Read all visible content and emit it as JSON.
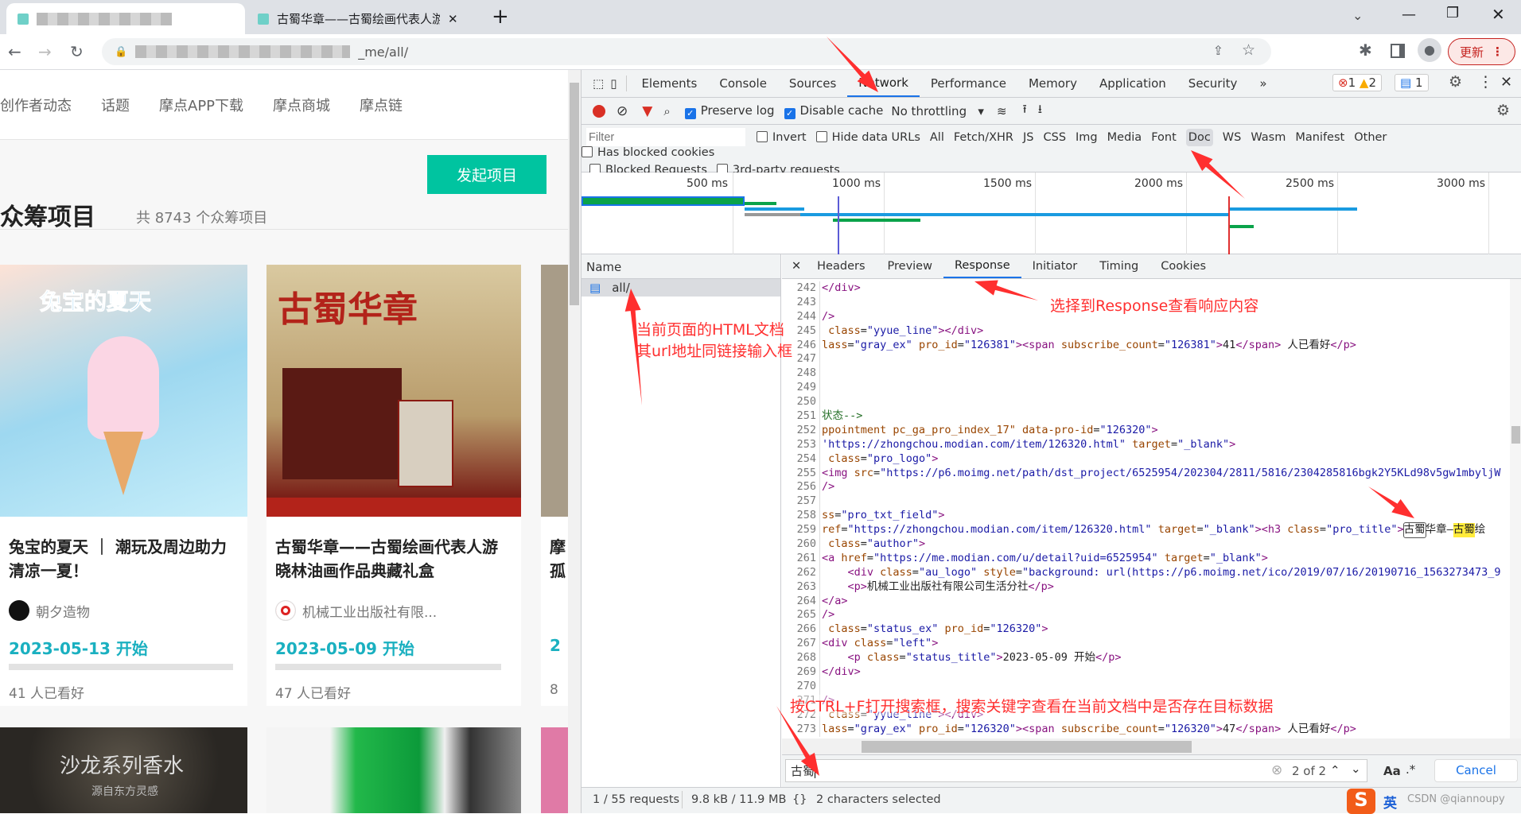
{
  "browser": {
    "tab1_title": "",
    "tab2_title": "古蜀华章——古蜀绘画代表人游晓",
    "url_visible": "_me/all/",
    "update_label": "更新"
  },
  "page": {
    "nav": [
      "创作者动态",
      "话题",
      "摩点APP下载",
      "摩点商城",
      "摩点链"
    ],
    "launch_button": "发起项目",
    "heading": "众筹项目",
    "count": "共 8743 个众筹项目",
    "cards": [
      {
        "title": "兔宝的夏天 ｜ 潮玩及周边助力清凉一夏！",
        "author": "朝夕造物",
        "date": "2023-05-13 开始",
        "watchers": "41 人已看好",
        "image_text": "兔宝的夏天",
        "image_color": "#9ed8f0"
      },
      {
        "title": "古蜀华章——古蜀绘画代表人游晓林油画作品典藏礼盒",
        "author": "机械工业出版社有限...",
        "date": "2023-05-09 开始",
        "watchers": "47 人已看好",
        "image_text": "古蜀华章",
        "image_color": "#c9b78a"
      },
      {
        "title": "摩孤",
        "author": "",
        "date": "2",
        "watchers": "8",
        "image_text": "",
        "image_color": "#a89c88"
      }
    ],
    "row2": [
      {
        "image_text": "沙龙系列香水",
        "image_sub": "源自东方灵感"
      },
      {
        "image_text": ""
      }
    ]
  },
  "devtools": {
    "tabs": [
      "Elements",
      "Console",
      "Sources",
      "Network",
      "Performance",
      "Memory",
      "Application",
      "Security",
      "»"
    ],
    "active_tab": "Network",
    "errors": "1",
    "warnings": "2",
    "messages": "1",
    "toolbar": {
      "preserve_log": "Preserve log",
      "disable_cache": "Disable cache",
      "throttling": "No throttling"
    },
    "filter": {
      "placeholder": "Filter",
      "invert": "Invert",
      "hide_data_urls": "Hide data URLs",
      "types": [
        "All",
        "Fetch/XHR",
        "JS",
        "CSS",
        "Img",
        "Media",
        "Font",
        "Doc",
        "WS",
        "Wasm",
        "Manifest",
        "Other"
      ],
      "active_type": "Doc",
      "has_blocked_cookies": "Has blocked cookies",
      "blocked_requests": "Blocked Requests",
      "third_party": "3rd-party requests"
    },
    "timeline_ticks": [
      "500 ms",
      "1000 ms",
      "1500 ms",
      "2000 ms",
      "2500 ms",
      "3000 ms"
    ],
    "name_header": "Name",
    "requests": [
      "all/"
    ],
    "detail_tabs": [
      "Headers",
      "Preview",
      "Response",
      "Initiator",
      "Timing",
      "Cookies"
    ],
    "active_detail_tab": "Response",
    "code": [
      [
        242,
        [
          [
            "t",
            "</div>"
          ]
        ]
      ],
      [
        243,
        []
      ],
      [
        244,
        [
          [
            "t",
            "/>"
          ]
        ]
      ],
      [
        245,
        [
          [
            "x",
            " "
          ],
          [
            "a",
            "class"
          ],
          [
            "x",
            "="
          ],
          [
            "v",
            "\"yyue_line\""
          ],
          [
            "t",
            "></div>"
          ]
        ]
      ],
      [
        246,
        [
          [
            "a",
            "lass"
          ],
          [
            "x",
            "="
          ],
          [
            "v",
            "\"gray_ex\""
          ],
          [
            "x",
            " "
          ],
          [
            "a",
            "pro_id"
          ],
          [
            "x",
            "="
          ],
          [
            "v",
            "\"126381\""
          ],
          [
            "t",
            "><span "
          ],
          [
            "a",
            "subscribe_count"
          ],
          [
            "x",
            "="
          ],
          [
            "v",
            "\"126381\""
          ],
          [
            "t",
            ">"
          ],
          [
            "x",
            "41"
          ],
          [
            "t",
            "</span>"
          ],
          [
            "x",
            " 人已看好"
          ],
          [
            "t",
            "</p>"
          ]
        ]
      ],
      [
        247,
        []
      ],
      [
        248,
        []
      ],
      [
        249,
        []
      ],
      [
        250,
        []
      ],
      [
        251,
        [
          [
            "c",
            "状态-->"
          ]
        ]
      ],
      [
        252,
        [
          [
            "a",
            "ppointment pc_ga_pro_index_17\" data-pro-id"
          ],
          [
            "x",
            "="
          ],
          [
            "v",
            "\"126320\""
          ],
          [
            "t",
            ">"
          ]
        ]
      ],
      [
        253,
        [
          [
            "v",
            "'https://zhongchou.modian.com/item/126320.html\""
          ],
          [
            "x",
            " "
          ],
          [
            "a",
            "target"
          ],
          [
            "x",
            "="
          ],
          [
            "v",
            "\"_blank\""
          ],
          [
            "t",
            ">"
          ]
        ]
      ],
      [
        254,
        [
          [
            "x",
            " "
          ],
          [
            "a",
            "class"
          ],
          [
            "x",
            "="
          ],
          [
            "v",
            "\"pro_logo\""
          ],
          [
            "t",
            ">"
          ]
        ]
      ],
      [
        255,
        [
          [
            "t",
            "<img "
          ],
          [
            "a",
            "src"
          ],
          [
            "x",
            "="
          ],
          [
            "v",
            "\"https://p6.moimg.net/path/dst_project/6525954/202304/2811/5816/2304285816bgk2Y5KLd98v5gw1mbyljW"
          ]
        ]
      ],
      [
        256,
        [
          [
            "t",
            "/>"
          ]
        ]
      ],
      [
        257,
        []
      ],
      [
        258,
        [
          [
            "a",
            "ss"
          ],
          [
            "x",
            "="
          ],
          [
            "v",
            "\"pro_txt_field\""
          ],
          [
            "t",
            ">"
          ]
        ]
      ],
      [
        259,
        [
          [
            "a",
            "ref"
          ],
          [
            "x",
            "="
          ],
          [
            "v",
            "\"https://zhongchou.modian.com/item/126320.html\""
          ],
          [
            "x",
            " "
          ],
          [
            "a",
            "target"
          ],
          [
            "x",
            "="
          ],
          [
            "v",
            "\"_blank\""
          ],
          [
            "t",
            "><h3 "
          ],
          [
            "a",
            "class"
          ],
          [
            "x",
            "="
          ],
          [
            "v",
            "\"pro_title\""
          ],
          [
            "t",
            ">"
          ],
          [
            "cur",
            "古蜀"
          ],
          [
            "x",
            "华章—"
          ],
          [
            "hl",
            "古蜀"
          ],
          [
            "x",
            "绘"
          ]
        ]
      ],
      [
        260,
        [
          [
            "x",
            " "
          ],
          [
            "a",
            "class"
          ],
          [
            "x",
            "="
          ],
          [
            "v",
            "\"author\""
          ],
          [
            "t",
            ">"
          ]
        ]
      ],
      [
        261,
        [
          [
            "t",
            "<a "
          ],
          [
            "a",
            "href"
          ],
          [
            "x",
            "="
          ],
          [
            "v",
            "\"https://me.modian.com/u/detail?uid=6525954\""
          ],
          [
            "x",
            " "
          ],
          [
            "a",
            "target"
          ],
          [
            "x",
            "="
          ],
          [
            "v",
            "\"_blank\""
          ],
          [
            "t",
            ">"
          ]
        ]
      ],
      [
        262,
        [
          [
            "t",
            "    <div "
          ],
          [
            "a",
            "class"
          ],
          [
            "x",
            "="
          ],
          [
            "v",
            "\"au_logo\""
          ],
          [
            "x",
            " "
          ],
          [
            "a",
            "style"
          ],
          [
            "x",
            "="
          ],
          [
            "v",
            "\"background: url(https://p6.moimg.net/ico/2019/07/16/20190716_1563273473_9"
          ]
        ]
      ],
      [
        263,
        [
          [
            "t",
            "    <p>"
          ],
          [
            "x",
            "机械工业出版社有限公司生活分社"
          ],
          [
            "t",
            "</p>"
          ]
        ]
      ],
      [
        264,
        [
          [
            "t",
            "</a>"
          ]
        ]
      ],
      [
        265,
        [
          [
            "t",
            "/>"
          ]
        ]
      ],
      [
        266,
        [
          [
            "x",
            " "
          ],
          [
            "a",
            "class"
          ],
          [
            "x",
            "="
          ],
          [
            "v",
            "\"status_ex\""
          ],
          [
            "x",
            " "
          ],
          [
            "a",
            "pro_id"
          ],
          [
            "x",
            "="
          ],
          [
            "v",
            "\"126320\""
          ],
          [
            "t",
            ">"
          ]
        ]
      ],
      [
        267,
        [
          [
            "t",
            "<div "
          ],
          [
            "a",
            "class"
          ],
          [
            "x",
            "="
          ],
          [
            "v",
            "\"left\""
          ],
          [
            "t",
            ">"
          ]
        ]
      ],
      [
        268,
        [
          [
            "t",
            "    <p "
          ],
          [
            "a",
            "class"
          ],
          [
            "x",
            "="
          ],
          [
            "v",
            "\"status_title\""
          ],
          [
            "t",
            ">"
          ],
          [
            "x",
            "2023-05-09 开始"
          ],
          [
            "t",
            "</p>"
          ]
        ]
      ],
      [
        269,
        [
          [
            "t",
            "</div>"
          ]
        ]
      ],
      [
        270,
        []
      ],
      [
        271,
        [
          [
            "t",
            "/>"
          ]
        ]
      ],
      [
        272,
        [
          [
            "x",
            " "
          ],
          [
            "a",
            "class"
          ],
          [
            "x",
            "="
          ],
          [
            "v",
            "\"yyue_line\""
          ],
          [
            "t",
            "></div>"
          ]
        ]
      ],
      [
        273,
        [
          [
            "a",
            "lass"
          ],
          [
            "x",
            "="
          ],
          [
            "v",
            "\"gray_ex\""
          ],
          [
            "x",
            " "
          ],
          [
            "a",
            "pro_id"
          ],
          [
            "x",
            "="
          ],
          [
            "v",
            "\"126320\""
          ],
          [
            "t",
            "><span "
          ],
          [
            "a",
            "subscribe_count"
          ],
          [
            "x",
            "="
          ],
          [
            "v",
            "\"126320\""
          ],
          [
            "t",
            ">"
          ],
          [
            "x",
            "47"
          ],
          [
            "t",
            "</span>"
          ],
          [
            "x",
            " 人已看好"
          ],
          [
            "t",
            "</p>"
          ]
        ]
      ]
    ],
    "search": {
      "value": "古蜀",
      "match": "2 of 2",
      "case_label": "Aa",
      "regex_label": ".*",
      "cancel": "Cancel"
    },
    "status": {
      "requests": "1 / 55 requests",
      "transferred": "9.8 kB / 11.9 MB",
      "selection": "2 characters selected"
    }
  },
  "annotations": {
    "html_doc_line1": "当前页面的HTML文档",
    "html_doc_line2": "其url地址同链接输入框",
    "response": "选择到Response查看响应内容",
    "search": "按CTRL+F打开搜索框，搜索关键字查看在当前文档中是否存在目标数据",
    "color": "#ff2f2f"
  },
  "ime": {
    "lang": "英",
    "watermark": "CSDN @qiannoupy"
  }
}
